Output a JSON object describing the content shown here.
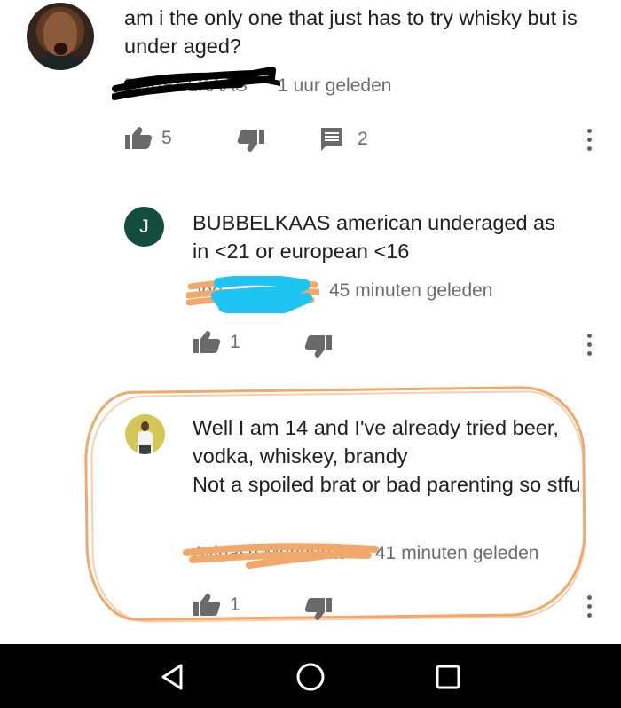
{
  "comments": [
    {
      "id": "main",
      "text": "am i the only one that just has to try whisky but is under aged?",
      "author": "BUBBELKAAS",
      "time": "1 uur geleden",
      "likes": "5",
      "replies": "2"
    },
    {
      "id": "reply1",
      "avatar_letter": "J",
      "text": "BUBBELKAAS american underaged as in <21 or european <16",
      "author": "Joe",
      "time": "45 minuten geleden",
      "likes": "1"
    },
    {
      "id": "reply2",
      "text": "Well I am 14 and I've already tried beer, vodka, whiskey, brandy\nNot a spoiled brat or bad parenting so stfu",
      "author": "Avinash Mondurao",
      "time": "41 minuten geleden",
      "likes": "1"
    }
  ],
  "icons": {
    "like": "thumb-up-icon",
    "dislike": "thumb-down-icon",
    "reply": "comment-icon",
    "more": "more-vert-icon",
    "nav_back": "back-triangle-icon",
    "nav_home": "home-circle-icon",
    "nav_recents": "recents-square-icon"
  },
  "colors": {
    "accent_orange": "#f0a86b",
    "redaction_blue": "#20c4f2",
    "redaction_black": "#000000",
    "reply_avatar": "#134d3d"
  }
}
